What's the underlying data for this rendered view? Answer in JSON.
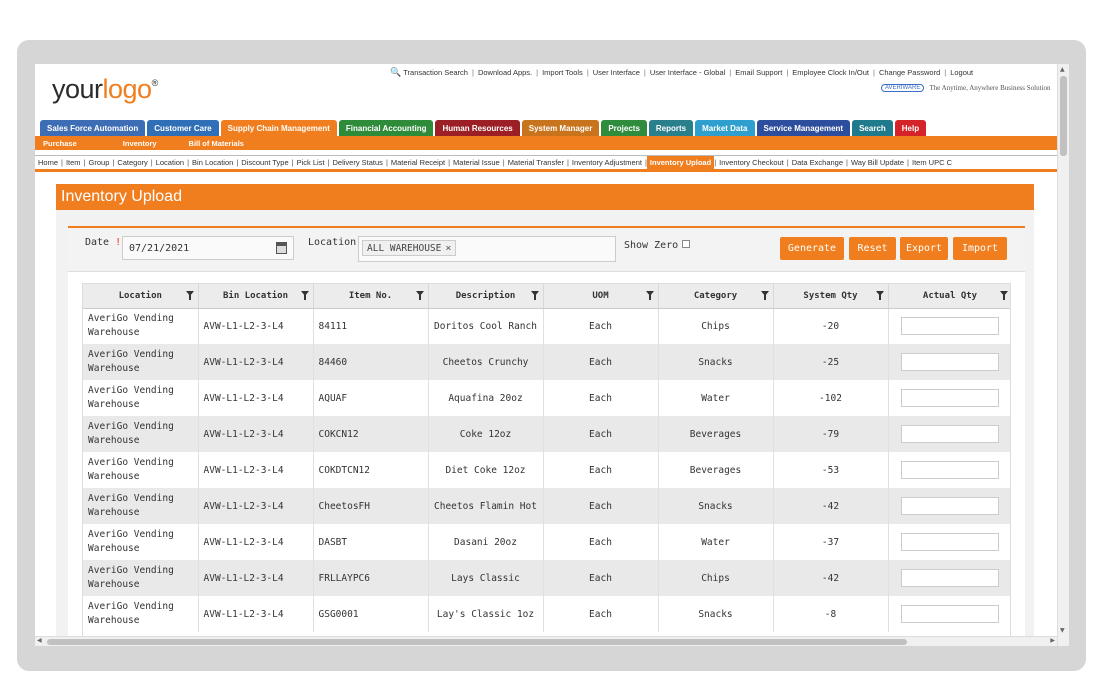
{
  "logo": {
    "text_a": "your",
    "text_b": "logo",
    "reg": "®"
  },
  "top_links": [
    "Transaction Search",
    "Download Apps.",
    "Import Tools",
    "User Interface",
    "User Interface - Global",
    "Email Support",
    "Employee Clock In/Out",
    "Change Password",
    "Logout"
  ],
  "brand": {
    "badge": "AVERIWARE",
    "tagline": "The Anytime, Anywhere Business Solution"
  },
  "main_nav": [
    {
      "label": "Sales Force Automation",
      "color": "#3d6db5"
    },
    {
      "label": "Customer Care",
      "color": "#2f6fb8"
    },
    {
      "label": "Supply Chain Management",
      "color": "#f07e1e"
    },
    {
      "label": "Financial Accounting",
      "color": "#2e8b3a"
    },
    {
      "label": "Human Resources",
      "color": "#9c1f25"
    },
    {
      "label": "System Manager",
      "color": "#c8741c"
    },
    {
      "label": "Projects",
      "color": "#2f8c3c"
    },
    {
      "label": "Reports",
      "color": "#2a7f8c"
    },
    {
      "label": "Market Data",
      "color": "#2f9fcf"
    },
    {
      "label": "Service Management",
      "color": "#2d4e9c"
    },
    {
      "label": "Search",
      "color": "#1f7a8c"
    },
    {
      "label": "Help",
      "color": "#d5232a"
    }
  ],
  "sub_nav": [
    "Purchase",
    "Inventory",
    "Bill of Materials"
  ],
  "third_nav": [
    "Home",
    "Item",
    "Group",
    "Category",
    "Location",
    "Bin Location",
    "Discount Type",
    "Pick List",
    "Delivery Status",
    "Material Receipt",
    "Material Issue",
    "Material Transfer",
    "Inventory Adjustment",
    "Inventory Upload",
    "Inventory Checkout",
    "Data Exchange",
    "Way Bill Update",
    "Item UPC C"
  ],
  "active_third": "Inventory Upload",
  "page_title": "Inventory Upload",
  "filter": {
    "date_label": "Date",
    "required": "!",
    "date_value": "07/21/2021",
    "location_label": "Location",
    "location_chip": "ALL WAREHOUSE",
    "chip_remove": "×",
    "show_zero_label": "Show Zero"
  },
  "buttons": {
    "generate": "Generate",
    "reset": "Reset",
    "export": "Export",
    "import": "Import"
  },
  "columns": [
    "Location",
    "Bin Location",
    "Item No.",
    "Description",
    "UOM",
    "Category",
    "System Qty",
    "Actual Qty"
  ],
  "rows": [
    {
      "location": "AveriGo Vending Warehouse",
      "bin": "AVW-L1-L2-3-L4",
      "item": "84111",
      "desc": "Doritos Cool Ranch",
      "uom": "Each",
      "category": "Chips",
      "sys_qty": "-20"
    },
    {
      "location": "AveriGo Vending Warehouse",
      "bin": "AVW-L1-L2-3-L4",
      "item": "84460",
      "desc": "Cheetos Crunchy",
      "uom": "Each",
      "category": "Snacks",
      "sys_qty": "-25"
    },
    {
      "location": "AveriGo Vending Warehouse",
      "bin": "AVW-L1-L2-3-L4",
      "item": "AQUAF",
      "desc": "Aquafina 20oz",
      "uom": "Each",
      "category": "Water",
      "sys_qty": "-102"
    },
    {
      "location": "AveriGo Vending Warehouse",
      "bin": "AVW-L1-L2-3-L4",
      "item": "COKCN12",
      "desc": "Coke 12oz",
      "uom": "Each",
      "category": "Beverages",
      "sys_qty": "-79"
    },
    {
      "location": "AveriGo Vending Warehouse",
      "bin": "AVW-L1-L2-3-L4",
      "item": "COKDTCN12",
      "desc": "Diet Coke 12oz",
      "uom": "Each",
      "category": "Beverages",
      "sys_qty": "-53"
    },
    {
      "location": "AveriGo Vending Warehouse",
      "bin": "AVW-L1-L2-3-L4",
      "item": "CheetosFH",
      "desc": "Cheetos Flamin Hot",
      "uom": "Each",
      "category": "Snacks",
      "sys_qty": "-42"
    },
    {
      "location": "AveriGo Vending Warehouse",
      "bin": "AVW-L1-L2-3-L4",
      "item": "DASBT",
      "desc": "Dasani 20oz",
      "uom": "Each",
      "category": "Water",
      "sys_qty": "-37"
    },
    {
      "location": "AveriGo Vending Warehouse",
      "bin": "AVW-L1-L2-3-L4",
      "item": "FRLLAYPC6",
      "desc": "Lays Classic",
      "uom": "Each",
      "category": "Chips",
      "sys_qty": "-42"
    },
    {
      "location": "AveriGo Vending Warehouse",
      "bin": "AVW-L1-L2-3-L4",
      "item": "GSG0001",
      "desc": "Lay's Classic 1oz",
      "uom": "Each",
      "category": "Snacks",
      "sys_qty": "-8"
    }
  ]
}
